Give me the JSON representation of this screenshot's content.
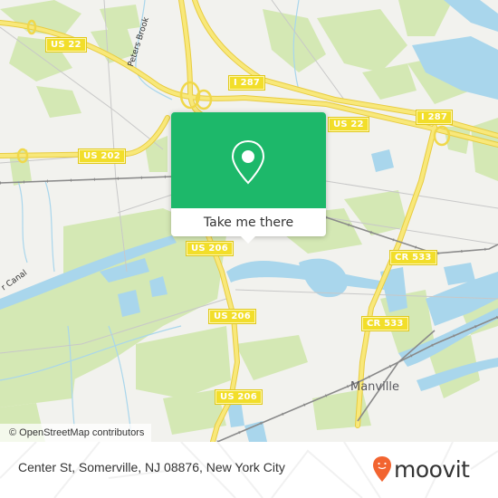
{
  "map": {
    "road_shields": [
      {
        "id": "us22-west",
        "label": "US 22"
      },
      {
        "id": "i287-center",
        "label": "I 287"
      },
      {
        "id": "us22-center",
        "label": "US 22"
      },
      {
        "id": "i287-east",
        "label": "I 287"
      },
      {
        "id": "us202",
        "label": "US 202"
      },
      {
        "id": "us206-north",
        "label": "US 206"
      },
      {
        "id": "cr533-north",
        "label": "CR 533"
      },
      {
        "id": "us206-mid",
        "label": "US 206"
      },
      {
        "id": "cr533-south",
        "label": "CR 533"
      },
      {
        "id": "us206-south",
        "label": "US 206"
      }
    ],
    "place_labels": [
      {
        "id": "manville",
        "label": "Manville"
      }
    ],
    "water_labels": [
      {
        "id": "peters-brook",
        "label": "Peters Brook"
      },
      {
        "id": "canal",
        "label": "r Canal"
      }
    ],
    "attribution": "© OpenStreetMap contributors",
    "colors": {
      "land": "#f2f2ee",
      "park": "#d4e8b4",
      "water": "#a9d6ec",
      "road": "#f5de5a",
      "rail": "#8a8a8a"
    }
  },
  "popup": {
    "icon": "location-pin-icon",
    "action_label": "Take me there",
    "accent_color": "#1db86a"
  },
  "footer": {
    "address": "Center St, Somerville, NJ 08876, New York City",
    "brand": "moovit",
    "brand_color": "#f26430"
  }
}
